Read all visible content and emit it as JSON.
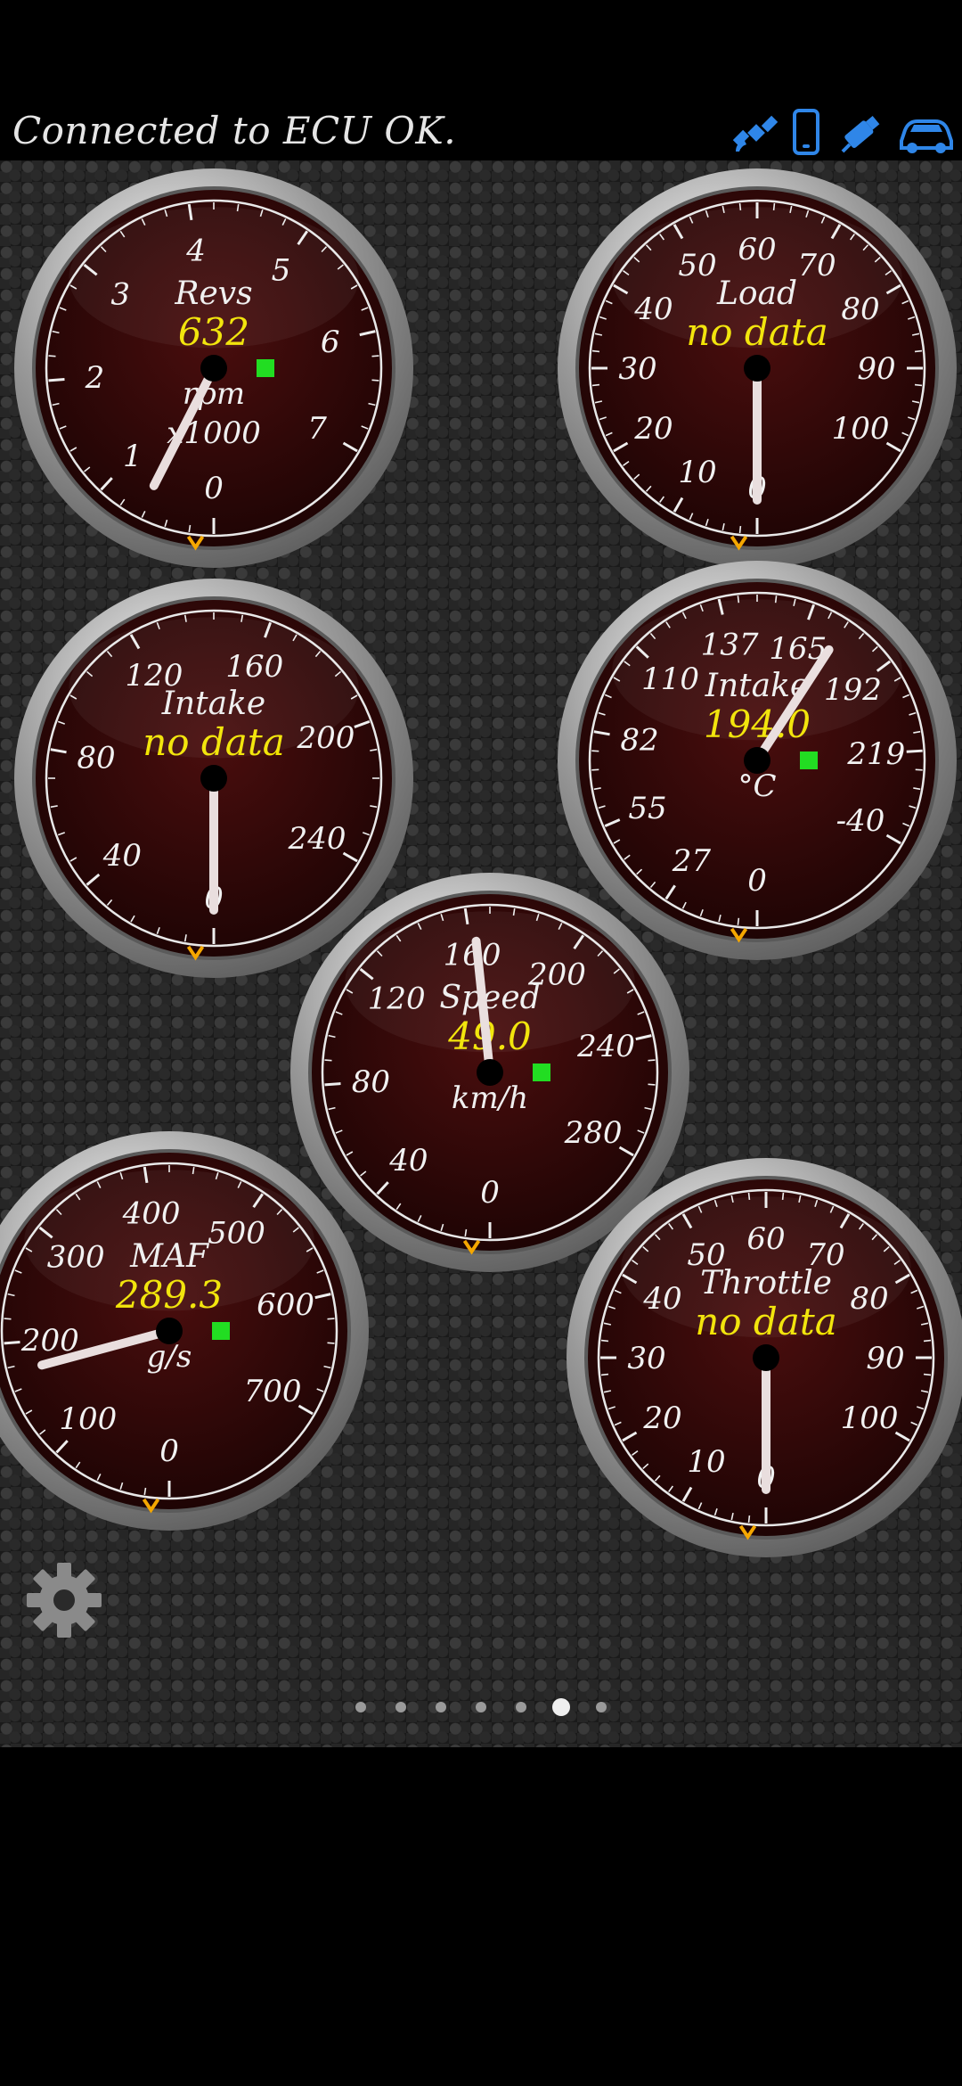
{
  "status": {
    "message": "Connected to ECU OK."
  },
  "colors": {
    "icon_blue": "#2f86e8",
    "gauge_face": "#3a0a0a",
    "value_yellow": "#f2e400",
    "indicator_green": "#22dd22",
    "needle": "#e9dede"
  },
  "toolbar": {
    "icons": [
      "satellite-icon",
      "phone-icon",
      "usb-adapter-icon",
      "car-icon"
    ]
  },
  "gauges": [
    {
      "id": "revs",
      "title": "Revs",
      "value": "632",
      "units": "rpm",
      "units2": "x1000",
      "ticks": [
        "0",
        "1",
        "2",
        "3",
        "4",
        "5",
        "6",
        "7"
      ],
      "needle_fraction": 0.09,
      "has_green_indicator": true
    },
    {
      "id": "load",
      "title": "Load",
      "value": "no data",
      "units": "",
      "units2": "",
      "ticks": [
        "0",
        "10",
        "20",
        "30",
        "40",
        "50",
        "60",
        "70",
        "80",
        "90",
        "100"
      ],
      "needle_fraction": 0.0,
      "has_green_indicator": false
    },
    {
      "id": "intake-pressure",
      "title": "Intake",
      "value": "no data",
      "units": "",
      "units2": "",
      "ticks": [
        "0",
        "40",
        "80",
        "120",
        "160",
        "200",
        "240"
      ],
      "needle_fraction": 0.0,
      "has_green_indicator": false
    },
    {
      "id": "intake-temp",
      "title": "Intake",
      "value": "194.0",
      "units": "°C",
      "units2": "",
      "ticks": [
        "0",
        "27",
        "55",
        "82",
        "110",
        "137",
        "165",
        "192",
        "219",
        "-40"
      ],
      "needle_fraction": 0.71,
      "has_green_indicator": true
    },
    {
      "id": "speed",
      "title": "Speed",
      "value": "49.0",
      "units": "km/h",
      "units2": "",
      "ticks": [
        "0",
        "40",
        "80",
        "120",
        "160",
        "200",
        "240",
        "280"
      ],
      "needle_fraction": 0.58,
      "has_green_indicator": true
    },
    {
      "id": "maf",
      "title": "MAF",
      "value": "289.3",
      "units": "g/s",
      "units2": "",
      "ticks": [
        "0",
        "100",
        "200",
        "300",
        "400",
        "500",
        "600",
        "700"
      ],
      "needle_fraction": 0.25,
      "has_green_indicator": true
    },
    {
      "id": "throttle",
      "title": "Throttle",
      "value": "no data",
      "units": "",
      "units2": "",
      "ticks": [
        "0",
        "10",
        "20",
        "30",
        "40",
        "50",
        "60",
        "70",
        "80",
        "90",
        "100"
      ],
      "needle_fraction": 0.0,
      "has_green_indicator": false
    }
  ],
  "pager": {
    "count": 7,
    "active_index": 5
  }
}
